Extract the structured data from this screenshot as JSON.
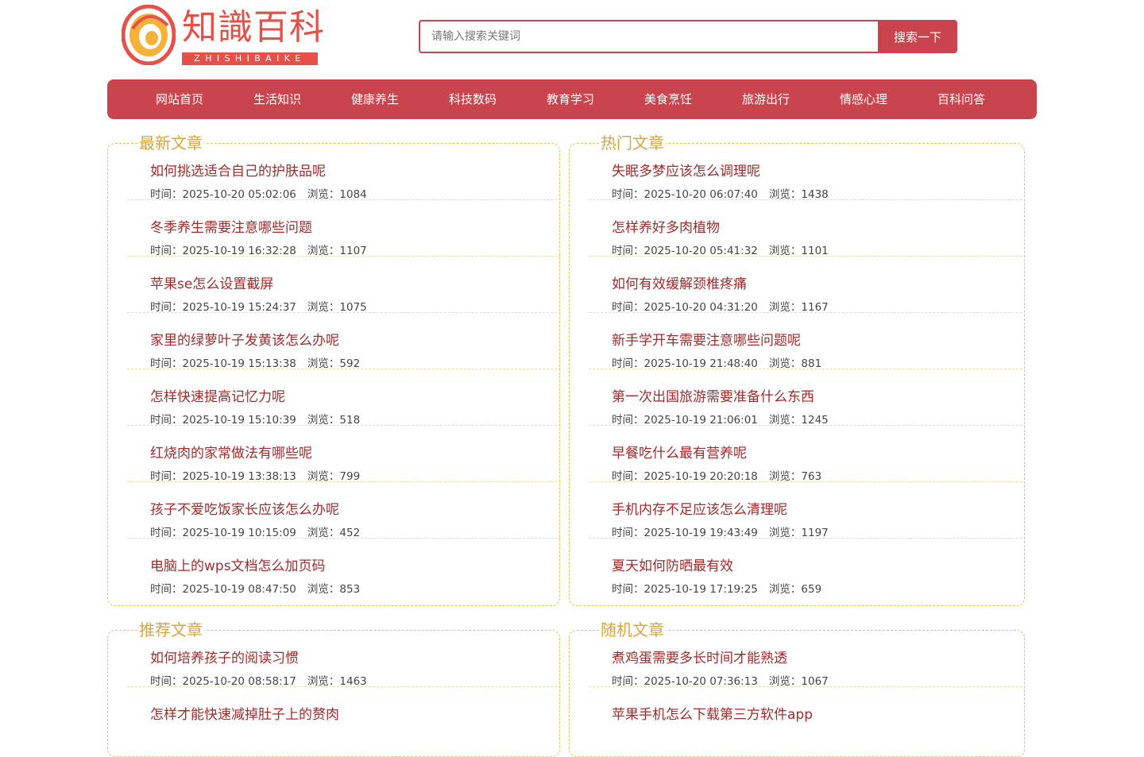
{
  "logo": {
    "name_cn": "知識百科",
    "name_en": "ZHISHIBAIKE",
    "colors": {
      "primary": "#e55148",
      "accent": "#f6b13a"
    }
  },
  "search": {
    "placeholder": "请输入搜索关键词",
    "button_label": "搜索一下"
  },
  "nav": {
    "items": [
      {
        "label": "网站首页"
      },
      {
        "label": "生活知识"
      },
      {
        "label": "健康养生"
      },
      {
        "label": "科技数码"
      },
      {
        "label": "教育学习"
      },
      {
        "label": "美食烹饪"
      },
      {
        "label": "旅游出行"
      },
      {
        "label": "情感心理"
      },
      {
        "label": "百科问答"
      }
    ]
  },
  "sections": [
    {
      "title": "最新文章",
      "items": [
        {
          "title": "如何挑选适合自己的护肤品呢",
          "time": "时间：2025-10-20 05:02:06",
          "views": "浏览：1084"
        },
        {
          "title": "冬季养生需要注意哪些问题",
          "time": "时间：2025-10-19 16:32:28",
          "views": "浏览：1107"
        },
        {
          "title": "苹果se怎么设置截屏",
          "time": "时间：2025-10-19 15:24:37",
          "views": "浏览：1075"
        },
        {
          "title": "家里的绿萝叶子发黄该怎么办呢",
          "time": "时间：2025-10-19 15:13:38",
          "views": "浏览：592"
        },
        {
          "title": "怎样快速提高记忆力呢",
          "time": "时间：2025-10-19 15:10:39",
          "views": "浏览：518"
        },
        {
          "title": "红烧肉的家常做法有哪些呢",
          "time": "时间：2025-10-19 13:38:13",
          "views": "浏览：799"
        },
        {
          "title": "孩子不爱吃饭家长应该怎么办呢",
          "time": "时间：2025-10-19 10:15:09",
          "views": "浏览：452"
        },
        {
          "title": "电脑上的wps文档怎么加页码",
          "time": "时间：2025-10-19 08:47:50",
          "views": "浏览：853"
        }
      ]
    },
    {
      "title": "热门文章",
      "items": [
        {
          "title": "失眠多梦应该怎么调理呢",
          "time": "时间：2025-10-20 06:07:40",
          "views": "浏览：1438"
        },
        {
          "title": "怎样养好多肉植物",
          "time": "时间：2025-10-20 05:41:32",
          "views": "浏览：1101"
        },
        {
          "title": "如何有效缓解颈椎疼痛",
          "time": "时间：2025-10-20 04:31:20",
          "views": "浏览：1167"
        },
        {
          "title": "新手学开车需要注意哪些问题呢",
          "time": "时间：2025-10-19 21:48:40",
          "views": "浏览：881"
        },
        {
          "title": "第一次出国旅游需要准备什么东西",
          "time": "时间：2025-10-19 21:06:01",
          "views": "浏览：1245"
        },
        {
          "title": "早餐吃什么最有营养呢",
          "time": "时间：2025-10-19 20:20:18",
          "views": "浏览：763"
        },
        {
          "title": "手机内存不足应该怎么清理呢",
          "time": "时间：2025-10-19 19:43:49",
          "views": "浏览：1197"
        },
        {
          "title": "夏天如何防晒最有效",
          "time": "时间：2025-10-19 17:19:25",
          "views": "浏览：659"
        }
      ]
    },
    {
      "title": "推荐文章",
      "items": [
        {
          "title": "如何培养孩子的阅读习惯",
          "time": "时间：2025-10-20 08:58:17",
          "views": "浏览：1463"
        },
        {
          "title": "怎样才能快速减掉肚子上的赘肉",
          "time": "",
          "views": ""
        }
      ]
    },
    {
      "title": "随机文章",
      "items": [
        {
          "title": "煮鸡蛋需要多长时间才能熟透",
          "time": "时间：2025-10-20 07:36:13",
          "views": "浏览：1067"
        },
        {
          "title": "苹果手机怎么下载第三方软件app",
          "time": "",
          "views": ""
        }
      ]
    }
  ]
}
